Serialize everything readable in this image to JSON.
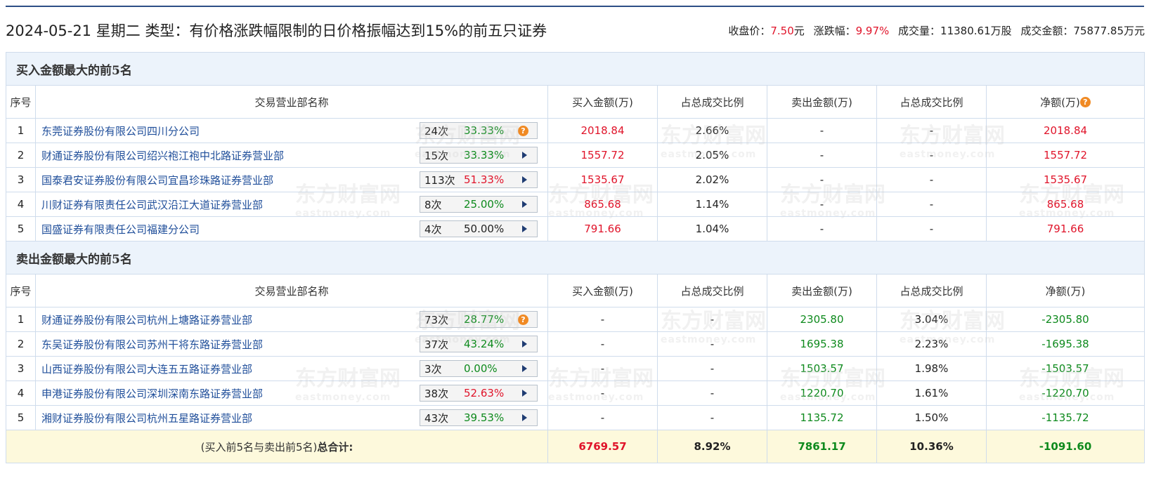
{
  "header": {
    "title": "2024-05-21 星期二 类型：有价格涨跌幅限制的日价格振幅达到15%的前五只证券",
    "close_label": "收盘价：",
    "close_value": "7.50",
    "close_unit": "元",
    "change_label": "涨跌幅：",
    "change_value": "9.97%",
    "volume_label": "成交量：",
    "volume_value": "11380.61万股",
    "amount_label": "成交金额：",
    "amount_value": "75877.85万元"
  },
  "watermark": {
    "cn": "东方财富网",
    "en": "eastmoney.com"
  },
  "buy_section": {
    "title": "买入金额最大的前5名",
    "headers": [
      "序号",
      "交易营业部名称",
      "买入金额(万)",
      "占总成交比例",
      "卖出金额(万)",
      "占总成交比例",
      "净额(万)"
    ],
    "rows": [
      {
        "idx": "1",
        "name": "东莞证券股份有限公司四川分公司",
        "count": "24次",
        "pct": "33.33%",
        "pct_color": "green",
        "icon": "question",
        "buy": "2018.84",
        "buy_ratio": "2.66%",
        "sell": "-",
        "sell_ratio": "-",
        "net": "2018.84"
      },
      {
        "idx": "2",
        "name": "财通证券股份有限公司绍兴袍江袍中北路证券营业部",
        "count": "15次",
        "pct": "33.33%",
        "pct_color": "green",
        "icon": "arrow",
        "buy": "1557.72",
        "buy_ratio": "2.05%",
        "sell": "-",
        "sell_ratio": "-",
        "net": "1557.72"
      },
      {
        "idx": "3",
        "name": "国泰君安证券股份有限公司宜昌珍珠路证券营业部",
        "count": "113次",
        "pct": "51.33%",
        "pct_color": "red",
        "icon": "arrow",
        "buy": "1535.67",
        "buy_ratio": "2.02%",
        "sell": "-",
        "sell_ratio": "-",
        "net": "1535.67"
      },
      {
        "idx": "4",
        "name": "川财证券有限责任公司武汉沿江大道证券营业部",
        "count": "8次",
        "pct": "25.00%",
        "pct_color": "green",
        "icon": "arrow",
        "buy": "865.68",
        "buy_ratio": "1.14%",
        "sell": "-",
        "sell_ratio": "-",
        "net": "865.68"
      },
      {
        "idx": "5",
        "name": "国盛证券有限责任公司福建分公司",
        "count": "4次",
        "pct": "50.00%",
        "pct_color": "black",
        "icon": "arrow",
        "buy": "791.66",
        "buy_ratio": "1.04%",
        "sell": "-",
        "sell_ratio": "-",
        "net": "791.66"
      }
    ]
  },
  "sell_section": {
    "title": "卖出金额最大的前5名",
    "headers": [
      "序号",
      "交易营业部名称",
      "买入金额(万)",
      "占总成交比例",
      "卖出金额(万)",
      "占总成交比例",
      "净额(万)"
    ],
    "rows": [
      {
        "idx": "1",
        "name": "财通证券股份有限公司杭州上塘路证券营业部",
        "count": "73次",
        "pct": "28.77%",
        "pct_color": "green",
        "icon": "question",
        "buy": "-",
        "buy_ratio": "-",
        "sell": "2305.80",
        "sell_ratio": "3.04%",
        "net": "-2305.80"
      },
      {
        "idx": "2",
        "name": "东吴证券股份有限公司苏州干将东路证券营业部",
        "count": "37次",
        "pct": "43.24%",
        "pct_color": "green",
        "icon": "arrow",
        "buy": "-",
        "buy_ratio": "-",
        "sell": "1695.38",
        "sell_ratio": "2.23%",
        "net": "-1695.38"
      },
      {
        "idx": "3",
        "name": "山西证券股份有限公司大连五五路证券营业部",
        "count": "3次",
        "pct": "0.00%",
        "pct_color": "green",
        "icon": "arrow",
        "buy": "-",
        "buy_ratio": "-",
        "sell": "1503.57",
        "sell_ratio": "1.98%",
        "net": "-1503.57"
      },
      {
        "idx": "4",
        "name": "申港证券股份有限公司深圳深南东路证券营业部",
        "count": "38次",
        "pct": "52.63%",
        "pct_color": "red",
        "icon": "arrow",
        "buy": "-",
        "buy_ratio": "-",
        "sell": "1220.70",
        "sell_ratio": "1.61%",
        "net": "-1220.70"
      },
      {
        "idx": "5",
        "name": "湘财证券股份有限公司杭州五星路证券营业部",
        "count": "43次",
        "pct": "39.53%",
        "pct_color": "green",
        "icon": "arrow",
        "buy": "-",
        "buy_ratio": "-",
        "sell": "1135.72",
        "sell_ratio": "1.50%",
        "net": "-1135.72"
      }
    ]
  },
  "total": {
    "label_prefix": "(买入前5名与卖出前5名)",
    "label_bold": "总合计:",
    "buy": "6769.57",
    "buy_ratio": "8.92%",
    "sell": "7861.17",
    "sell_ratio": "10.36%",
    "net": "-1091.60"
  },
  "colors": {
    "up": "#e0142a",
    "down": "#0e8a1d",
    "link": "#1f4e9a",
    "section_bg": "#ecf3fb",
    "total_bg": "#fdf9dc"
  }
}
